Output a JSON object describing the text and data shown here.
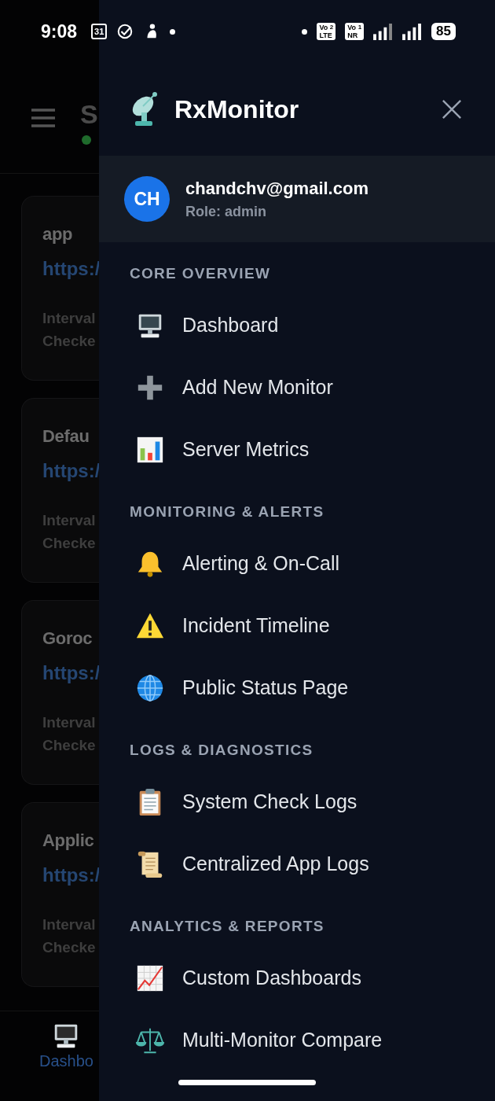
{
  "status_bar": {
    "time": "9:08",
    "calendar_day": "31",
    "battery": "85",
    "sims": [
      {
        "top": "Vo",
        "bottom": "LTE",
        "slot": "2"
      },
      {
        "top": "Vo",
        "bottom": "NR",
        "slot": "1"
      }
    ]
  },
  "background": {
    "header_title": "S",
    "cards": [
      {
        "name": "app",
        "url": "https:/",
        "line_1": "Interval",
        "line_2": "Checke"
      },
      {
        "name": "Defau",
        "url": "https:/",
        "line_1": "Interval",
        "line_2": "Checke"
      },
      {
        "name": "Goroc",
        "url": "https:/",
        "line_1": "Interval",
        "line_2": "Checke"
      },
      {
        "name": "Applic",
        "url": "https:/",
        "line_1": "Interval",
        "line_2": "Checke"
      }
    ],
    "bottom_nav": [
      {
        "label": "Dashbo",
        "selected": true
      }
    ]
  },
  "drawer": {
    "title": "RxMonitor",
    "user": {
      "initials": "CH",
      "email": "chandchv@gmail.com",
      "role": "Role: admin"
    },
    "sections": [
      {
        "heading": "CORE OVERVIEW",
        "items": [
          {
            "label": "Dashboard"
          },
          {
            "label": "Add New Monitor"
          },
          {
            "label": "Server Metrics"
          }
        ]
      },
      {
        "heading": "MONITORING & ALERTS",
        "items": [
          {
            "label": "Alerting & On-Call"
          },
          {
            "label": "Incident Timeline"
          },
          {
            "label": "Public Status Page"
          }
        ]
      },
      {
        "heading": "LOGS & DIAGNOSTICS",
        "items": [
          {
            "label": "System Check Logs"
          },
          {
            "label": "Centralized App Logs"
          }
        ]
      },
      {
        "heading": "ANALYTICS & REPORTS",
        "items": [
          {
            "label": "Custom Dashboards"
          },
          {
            "label": "Multi-Monitor Compare"
          }
        ]
      }
    ]
  }
}
